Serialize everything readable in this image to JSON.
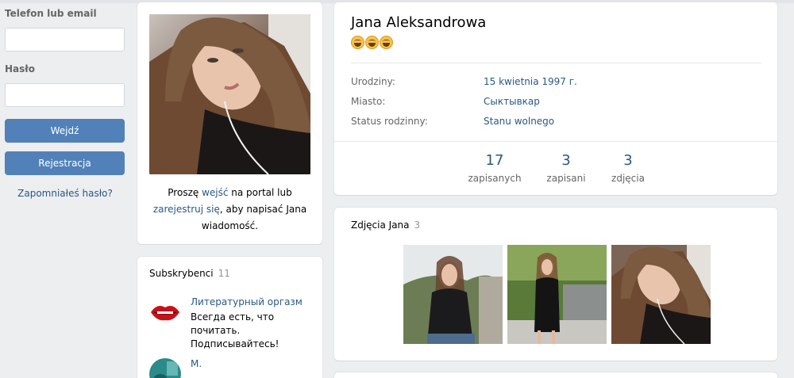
{
  "login": {
    "phone_label": "Telefon lub email",
    "phone_value": "",
    "password_label": "Hasło",
    "password_value": "",
    "login_button": "Wejdź",
    "register_button": "Rejestracja",
    "forgot_link": "Zapomniałeś hasło?"
  },
  "profile_photo_card": {
    "prompt_before": "Proszę ",
    "prompt_login_link": "wejść",
    "prompt_middle": " na portal lub ",
    "prompt_register_link": "zarejestruj się",
    "prompt_after": ", aby napisać Jana wiadomość."
  },
  "subscribers": {
    "title": "Subskrybenci",
    "count": "11",
    "items": [
      {
        "name": "Литературный оргазм",
        "description": "Всегда есть, что почитать. Подписывайтесь!",
        "avatar_icon": "lips-icon"
      },
      {
        "name": "M.",
        "description": "",
        "avatar_icon": "teal-avatar"
      }
    ]
  },
  "profile": {
    "name": "Jana Aleksandrowa",
    "status_emoji": "🤗🤗🤗",
    "info": [
      {
        "key": "Urodziny:",
        "value": "15 kwietnia 1997 г."
      },
      {
        "key": "Miasto:",
        "value": "Сыктывкар"
      },
      {
        "key": "Status rodzinny:",
        "value": "Stanu wolnego"
      }
    ],
    "counters": [
      {
        "num": "17",
        "label": "zapisanych"
      },
      {
        "num": "3",
        "label": "zapisani"
      },
      {
        "num": "3",
        "label": "zdjęcia"
      }
    ]
  },
  "photos": {
    "title": "Zdjęcia Jana",
    "count": "3"
  },
  "colors": {
    "background": "#edeef0",
    "accent": "#5181b8",
    "link": "#2a5885"
  }
}
